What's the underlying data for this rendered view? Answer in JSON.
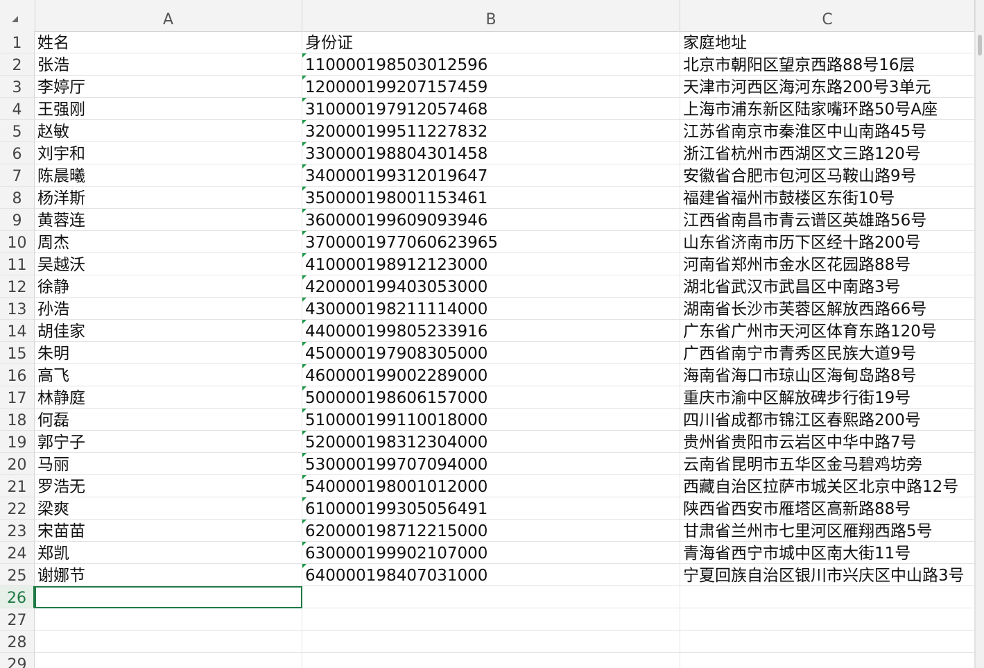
{
  "columns": [
    "A",
    "B",
    "C"
  ],
  "rows": [
    {
      "num": "1",
      "a": "姓名",
      "b": "身份证",
      "c": "家庭地址",
      "b_text_flag": false
    },
    {
      "num": "2",
      "a": "张浩",
      "b": "110000198503012596",
      "c": "北京市朝阳区望京西路88号16层",
      "b_text_flag": true
    },
    {
      "num": "3",
      "a": "李婷厅",
      "b": "120000199207157459",
      "c": "天津市河西区海河东路200号3单元",
      "b_text_flag": true
    },
    {
      "num": "4",
      "a": "王强刚",
      "b": "310000197912057468",
      "c": "上海市浦东新区陆家嘴环路50号A座",
      "b_text_flag": true
    },
    {
      "num": "5",
      "a": "赵敏",
      "b": "320000199511227832",
      "c": "江苏省南京市秦淮区中山南路45号",
      "b_text_flag": true
    },
    {
      "num": "6",
      "a": "刘宇和",
      "b": "330000198804301458",
      "c": "浙江省杭州市西湖区文三路120号",
      "b_text_flag": true
    },
    {
      "num": "7",
      "a": "陈晨曦",
      "b": "340000199312019647",
      "c": "安徽省合肥市包河区马鞍山路9号",
      "b_text_flag": true
    },
    {
      "num": "8",
      "a": "杨洋斯",
      "b": "350000198001153461",
      "c": "福建省福州市鼓楼区东街10号",
      "b_text_flag": true
    },
    {
      "num": "9",
      "a": "黄蓉连",
      "b": "360000199609093946",
      "c": "江西省南昌市青云谱区英雄路56号",
      "b_text_flag": true
    },
    {
      "num": "10",
      "a": "周杰",
      "b": "3700001977060623965",
      "c": "山东省济南市历下区经十路200号",
      "b_text_flag": true
    },
    {
      "num": "11",
      "a": "吴越沃",
      "b": "410000198912123000",
      "c": "河南省郑州市金水区花园路88号",
      "b_text_flag": true
    },
    {
      "num": "12",
      "a": "徐静",
      "b": "420000199403053000",
      "c": "湖北省武汉市武昌区中南路3号",
      "b_text_flag": true
    },
    {
      "num": "13",
      "a": "孙浩",
      "b": "430000198211114000",
      "c": "湖南省长沙市芙蓉区解放西路66号",
      "b_text_flag": true
    },
    {
      "num": "14",
      "a": "胡佳家",
      "b": "440000199805233916",
      "c": "广东省广州市天河区体育东路120号",
      "b_text_flag": true
    },
    {
      "num": "15",
      "a": "朱明",
      "b": "450000197908305000",
      "c": "广西省南宁市青秀区民族大道9号",
      "b_text_flag": true
    },
    {
      "num": "16",
      "a": "高飞",
      "b": "460000199002289000",
      "c": "海南省海口市琼山区海甸岛路8号",
      "b_text_flag": true
    },
    {
      "num": "17",
      "a": "林静庭",
      "b": "500000198606157000",
      "c": "重庆市渝中区解放碑步行街19号",
      "b_text_flag": true
    },
    {
      "num": "18",
      "a": "何磊",
      "b": "510000199110018000",
      "c": "四川省成都市锦江区春熙路200号",
      "b_text_flag": true
    },
    {
      "num": "19",
      "a": "郭宁子",
      "b": "520000198312304000",
      "c": "贵州省贵阳市云岩区中华中路7号",
      "b_text_flag": true
    },
    {
      "num": "20",
      "a": "马丽",
      "b": "530000199707094000",
      "c": "云南省昆明市五华区金马碧鸡坊旁",
      "b_text_flag": true
    },
    {
      "num": "21",
      "a": "罗浩无",
      "b": "540000198001012000",
      "c": "西藏自治区拉萨市城关区北京中路12号",
      "b_text_flag": true
    },
    {
      "num": "22",
      "a": "梁爽",
      "b": "610000199305056491",
      "c": "陕西省西安市雁塔区高新路88号",
      "b_text_flag": true
    },
    {
      "num": "23",
      "a": "宋苗苗",
      "b": "620000198712215000",
      "c": "甘肃省兰州市七里河区雁翔西路5号",
      "b_text_flag": true
    },
    {
      "num": "24",
      "a": "郑凯",
      "b": "630000199902107000",
      "c": "青海省西宁市城中区南大街11号",
      "b_text_flag": true
    },
    {
      "num": "25",
      "a": "谢娜节",
      "b": "640000198407031000",
      "c": "宁夏回族自治区银川市兴庆区中山路3号",
      "b_text_flag": true
    },
    {
      "num": "26",
      "a": "",
      "b": "",
      "c": "",
      "b_text_flag": false
    },
    {
      "num": "27",
      "a": "",
      "b": "",
      "c": "",
      "b_text_flag": false
    },
    {
      "num": "28",
      "a": "",
      "b": "",
      "c": "",
      "b_text_flag": false
    },
    {
      "num": "29",
      "a": "",
      "b": "",
      "c": "",
      "b_text_flag": false
    }
  ],
  "active_row": "26",
  "active_cell": "A26",
  "colors": {
    "accent": "#1f7a45",
    "text_flag": "#1c9a48",
    "header_bg": "#f3f3f3",
    "grid": "#e3e3e3"
  }
}
